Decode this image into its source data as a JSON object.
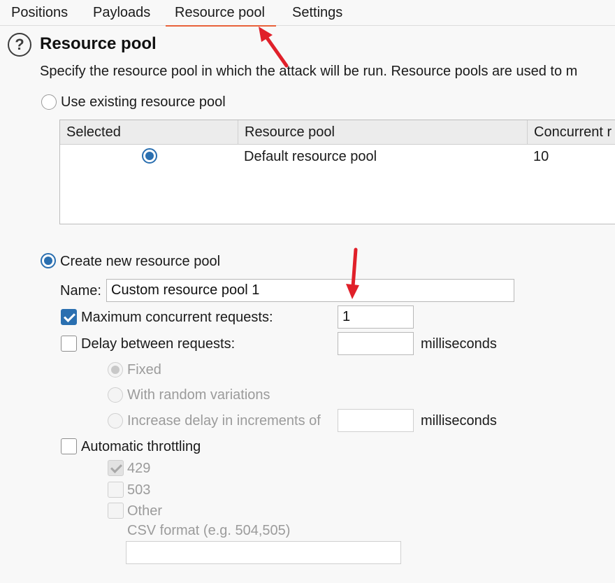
{
  "tabs": [
    {
      "label": "Positions"
    },
    {
      "label": "Payloads"
    },
    {
      "label": "Resource pool",
      "active": true
    },
    {
      "label": "Settings"
    }
  ],
  "section": {
    "help_icon": "question-circle-icon",
    "title": "Resource pool",
    "description": "Specify the resource pool in which the attack will be run. Resource pools are used to m"
  },
  "existing_pool": {
    "option_label": "Use existing resource pool",
    "selected": false,
    "columns": [
      "Selected",
      "Resource pool",
      "Concurrent r"
    ],
    "rows": [
      {
        "selected": true,
        "name": "Default resource pool",
        "concurrent": "10"
      }
    ]
  },
  "new_pool": {
    "option_label": "Create new resource pool",
    "selected": true,
    "name_label": "Name:",
    "name_value": "Custom resource pool 1",
    "max_concurrent": {
      "label": "Maximum concurrent requests:",
      "checked": true,
      "value": "1"
    },
    "delay": {
      "label": "Delay between requests:",
      "checked": false,
      "value": "",
      "unit": "milliseconds",
      "modes": [
        {
          "label": "Fixed",
          "selected": true
        },
        {
          "label": "With random variations",
          "selected": false
        },
        {
          "label": "Increase delay in increments of",
          "selected": false
        }
      ],
      "increment_value": "",
      "increment_unit": "milliseconds"
    },
    "throttling": {
      "label": "Automatic throttling",
      "checked": false,
      "codes": [
        {
          "label": "429",
          "checked": true
        },
        {
          "label": "503",
          "checked": false
        },
        {
          "label": "Other",
          "checked": false
        }
      ],
      "csv_label": "CSV format (e.g. 504,505)",
      "csv_value": ""
    }
  },
  "colors": {
    "accent": "#2a6fb0",
    "tab_underline": "#e8623a",
    "annotation_arrow": "#e0202a"
  }
}
